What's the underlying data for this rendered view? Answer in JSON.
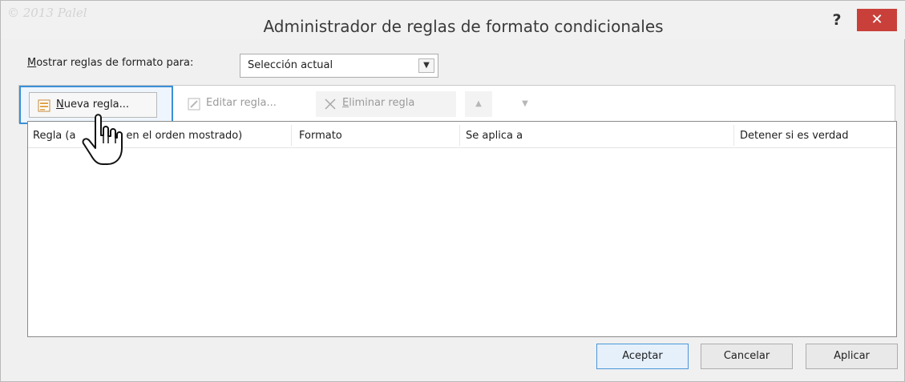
{
  "window": {
    "watermark": "© 2013 Palel",
    "title": "Administrador de reglas de formato condicionales",
    "help_label": "?",
    "close_label": "✕"
  },
  "filter": {
    "label_prefix": "M",
    "label_rest": "ostrar reglas de formato para:",
    "selected": "Selección actual"
  },
  "toolbar": {
    "new_rule_prefix": "N",
    "new_rule_rest": "ueva regla...",
    "edit_rule": "Editar regla...",
    "delete_rule_prefix": "E",
    "delete_rule_rest": "liminar regla",
    "move_up": "▲",
    "move_down": "▼"
  },
  "table": {
    "columns": [
      "Regla (a",
      "da en el orden mostrado)",
      "Formato",
      "Se aplica a",
      "Detener si es verdad"
    ],
    "rows": []
  },
  "footer": {
    "ok": "Aceptar",
    "cancel": "Cancelar",
    "apply": "Aplicar"
  },
  "colors": {
    "focus_border": "#3b8fd6",
    "close_button": "#c9403a"
  },
  "icons": [
    "new-rule-icon",
    "edit-rule-icon",
    "delete-icon",
    "move-up-icon",
    "move-down-icon",
    "dropdown-arrow-icon",
    "hand-cursor-icon"
  ]
}
